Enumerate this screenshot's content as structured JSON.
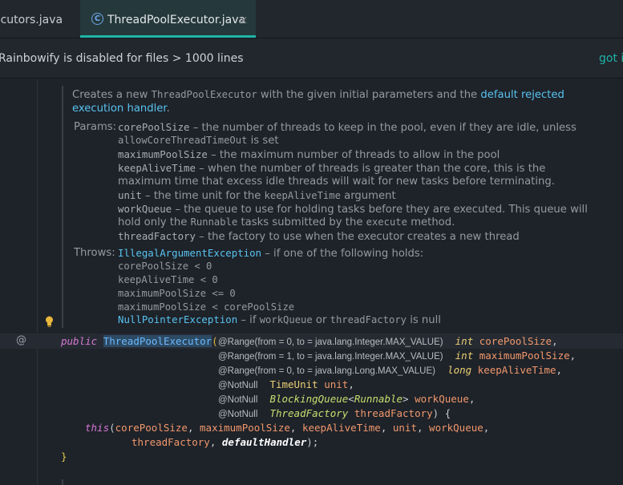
{
  "tabs": [
    {
      "label": "ecutors.java"
    },
    {
      "label": "ThreadPoolExecutor.java",
      "icon": "C",
      "close": "×"
    }
  ],
  "banner": {
    "text": "Rainbowify is disabled for files > 1000 lines",
    "link": "got it"
  },
  "doc": {
    "intro1_a": "Creates a new ",
    "intro1_code": "ThreadPoolExecutor",
    "intro1_b": " with the given initial parameters and the ",
    "intro1_link": "default rejected",
    "intro2_link": "execution handler",
    "intro2_b": ".",
    "params_label": "Params:",
    "params": [
      {
        "name": "corePoolSize",
        "text": " – the number of threads to keep in the pool, even if they are idle, unless"
      },
      {
        "code": "allowCoreThreadTimeOut",
        "text": " is set"
      },
      {
        "name": "maximumPoolSize",
        "text": " – the maximum number of threads to allow in the pool"
      },
      {
        "name": "keepAliveTime",
        "text": " – when the number of threads is greater than the core, this is the"
      },
      {
        "text": "maximum time that excess idle threads will wait for new tasks before terminating."
      },
      {
        "name": "unit",
        "text": " – the time unit for the ",
        "code": "keepAliveTime",
        "text2": " argument"
      },
      {
        "name": "workQueue",
        "text": " – the queue to use for holding tasks before they are executed. This queue will"
      },
      {
        "text": "hold only the ",
        "code": "Runnable",
        "text2": " tasks submitted by the ",
        "code2": "execute",
        "text3": " method."
      },
      {
        "name": "threadFactory",
        "text": " – the factory to use when the executor creates a new thread"
      }
    ],
    "throws_label": "Throws:",
    "throws_exc1": "IllegalArgumentException",
    "throws_exc1_text": " – if one of the following holds:",
    "conditions": [
      "corePoolSize < 0",
      "keepAliveTime < 0",
      "maximumPoolSize <= 0",
      "maximumPoolSize < corePoolSize"
    ],
    "throws_exc2": "NullPointerException",
    "throws_exc2_a": " – if ",
    "throws_exc2_code1": "workQueue",
    "throws_exc2_b": " or ",
    "throws_exc2_code2": "threadFactory",
    "throws_exc2_c": " is null"
  },
  "code": {
    "gutter_icon": "@",
    "kw_public": "public",
    "class_name": "ThreadPoolExecutor",
    "paren_open": "(",
    "params": [
      {
        "ann": "@Range(from = 0, to = java.lang.Integer.MAX_VALUE)",
        "type": "int",
        "name": "corePoolSize",
        "end": ","
      },
      {
        "ann": "@Range(from = 1, to = java.lang.Integer.MAX_VALUE)",
        "type": "int",
        "name": "maximumPoolSize",
        "end": ","
      },
      {
        "ann": "@Range(from = 0, to = java.lang.Long.MAX_VALUE)",
        "type": "long",
        "name": "keepAliveTime",
        "end": ","
      },
      {
        "ann": "@NotNull",
        "type": "TimeUnit",
        "name": "unit",
        "end": ","
      },
      {
        "ann": "@NotNull",
        "type": "BlockingQueue",
        "generic": "Runnable",
        "name": "workQueue",
        "end": ","
      },
      {
        "ann": "@NotNull",
        "type": "ThreadFactory",
        "name": "threadFactory",
        "end": ") {"
      }
    ],
    "this_kw": "this",
    "call_line1_args": [
      "corePoolSize",
      "maximumPoolSize",
      "keepAliveTime",
      "unit",
      "workQueue"
    ],
    "call_line2_arg1": "threadFactory",
    "call_line2_arg2": "defaultHandler",
    "call_end": ");",
    "brace_close": "}"
  },
  "colors": {
    "accent": "#1fb5a7",
    "link": "#58c3f0",
    "keyword": "#d777d4",
    "param": "#f0986c",
    "type": "#e9cf72"
  }
}
